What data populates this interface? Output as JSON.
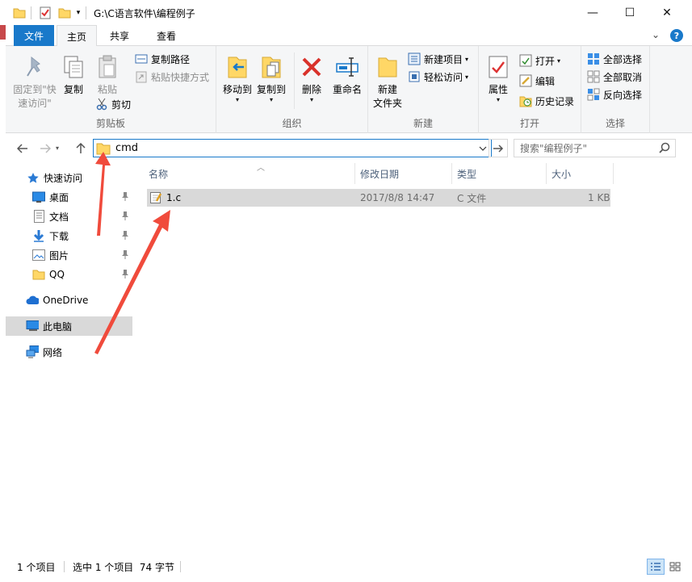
{
  "window": {
    "title": "G:\\C语言软件\\编程例子",
    "minimize_glyph": "—",
    "maximize_glyph": "☐",
    "close_glyph": "✕"
  },
  "ribbon_tabs": {
    "file": "文件",
    "home": "主页",
    "share": "共享",
    "view": "查看",
    "collapse_glyph": "⌄",
    "help_glyph": "?"
  },
  "ribbon": {
    "clipboard": {
      "label": "剪贴板",
      "pin_quick_access_line1": "固定到\"快",
      "pin_quick_access_line2": "速访问\"",
      "copy": "复制",
      "paste": "粘贴",
      "copy_path": "复制路径",
      "paste_shortcut": "粘贴快捷方式",
      "cut": "剪切"
    },
    "organize": {
      "label": "组织",
      "move_to": "移动到",
      "copy_to": "复制到",
      "delete": "删除",
      "rename": "重命名"
    },
    "new": {
      "label": "新建",
      "new_folder_line1": "新建",
      "new_folder_line2": "文件夹",
      "new_item": "新建项目",
      "easy_access": "轻松访问"
    },
    "open": {
      "label": "打开",
      "properties": "属性",
      "open": "打开",
      "edit": "编辑",
      "history": "历史记录"
    },
    "select": {
      "label": "选择",
      "select_all": "全部选择",
      "select_none": "全部取消",
      "invert_selection": "反向选择"
    }
  },
  "address_bar": {
    "value": "cmd",
    "search_placeholder": "搜索\"编程例子\""
  },
  "nav_pane": {
    "quick_access": "快速访问",
    "desktop": "桌面",
    "documents": "文档",
    "downloads": "下载",
    "pictures": "图片",
    "qq": "QQ",
    "onedrive": "OneDrive",
    "this_pc": "此电脑",
    "network": "网络"
  },
  "file_list": {
    "columns": {
      "name": "名称",
      "modified": "修改日期",
      "type": "类型",
      "size": "大小"
    },
    "rows": [
      {
        "name": "1.c",
        "modified": "2017/8/8 14:47",
        "type": "C 文件",
        "size": "1 KB"
      }
    ]
  },
  "status_bar": {
    "item_count": "1 个项目",
    "selected": "选中 1 个项目  74 字节"
  },
  "colors": {
    "accent": "#1979ca",
    "annotation_arrow": "#f04b3c",
    "folder": "#ffd766"
  }
}
